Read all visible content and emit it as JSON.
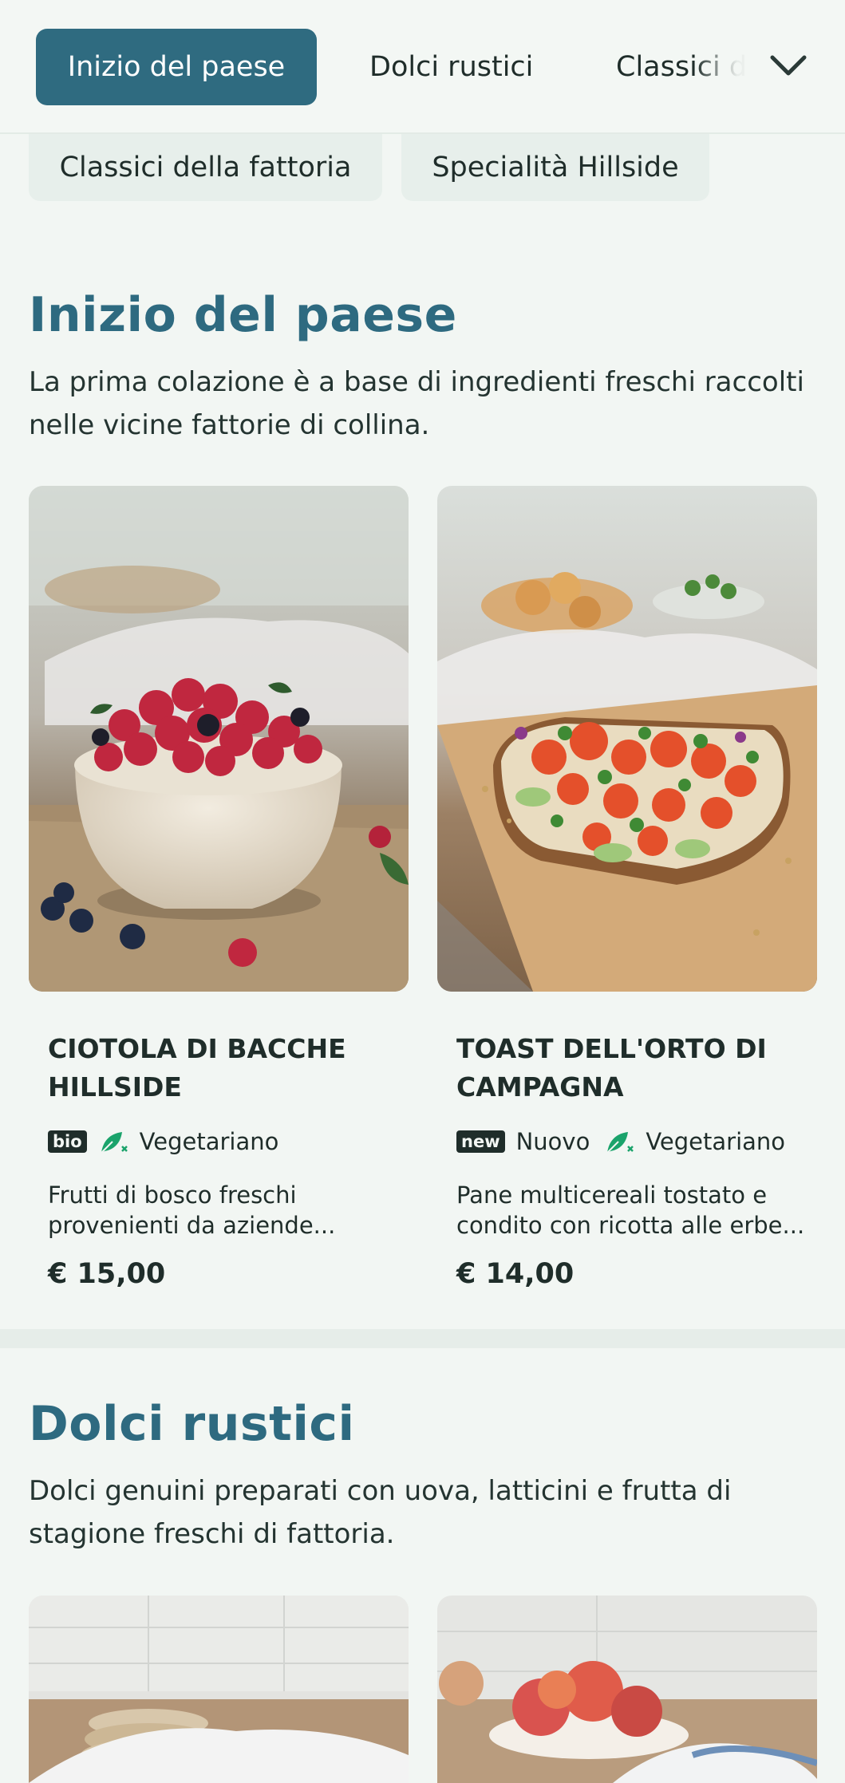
{
  "nav": {
    "tabs": [
      {
        "label": "Inizio del paese",
        "active": true
      },
      {
        "label": "Dolci rustici",
        "active": false
      },
      {
        "label": "Classici d",
        "active": false
      }
    ],
    "more_icon": "chevron-down-icon",
    "overflow_pills": [
      "Classici della fattoria",
      "Specialità Hillside"
    ]
  },
  "sections": [
    {
      "title": "Inizio del paese",
      "description": "La prima colazione è a base di ingredienti freschi raccolti nelle vicine fattorie di collina.",
      "items": [
        {
          "name": "CIOTOLA DI BACCHE HILLSIDE",
          "badges": [
            "bio"
          ],
          "diet": "Vegetariano",
          "description": "Frutti di bosco freschi provenienti da aziende...",
          "price": "€ 15,00"
        },
        {
          "name": "TOAST DELL'ORTO DI CAMPAGNA",
          "badges": [
            "new"
          ],
          "new_label": "Nuovo",
          "diet": "Vegetariano",
          "description": "Pane multicereali tostato e condito con ricotta alle erbe...",
          "price": "€ 14,00"
        }
      ]
    },
    {
      "title": "Dolci rustici",
      "description": "Dolci genuini preparati con uova, latticini e frutta di stagione freschi di fattoria."
    }
  ],
  "colors": {
    "accent": "#2f6b80",
    "title": "#2e6a80",
    "leaf": "#1aa36b",
    "background": "#f2f6f3"
  }
}
